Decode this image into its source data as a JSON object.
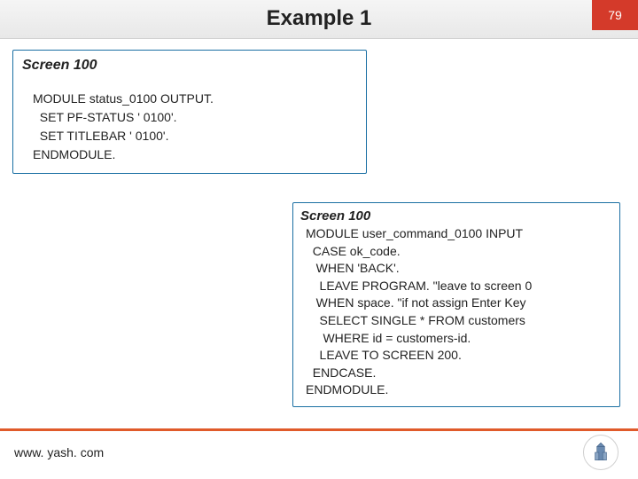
{
  "header": {
    "title": "Example 1",
    "page_number": "79"
  },
  "box1": {
    "label": "Screen 100",
    "code": "MODULE status_0100 OUTPUT.\n  SET PF-STATUS ' 0100'.\n  SET TITLEBAR ' 0100'.\nENDMODULE."
  },
  "box2": {
    "label": "Screen 100",
    "code": "MODULE user_command_0100 INPUT\n  CASE ok_code.\n   WHEN 'BACK'.\n    LEAVE PROGRAM. \"leave to screen 0\n   WHEN space. \"if not assign Enter Key\n    SELECT SINGLE * FROM customers\n     WHERE id = customers-id.\n    LEAVE TO SCREEN 200.\n  ENDCASE.\nENDMODULE."
  },
  "footer": {
    "url": "www. yash. com"
  }
}
